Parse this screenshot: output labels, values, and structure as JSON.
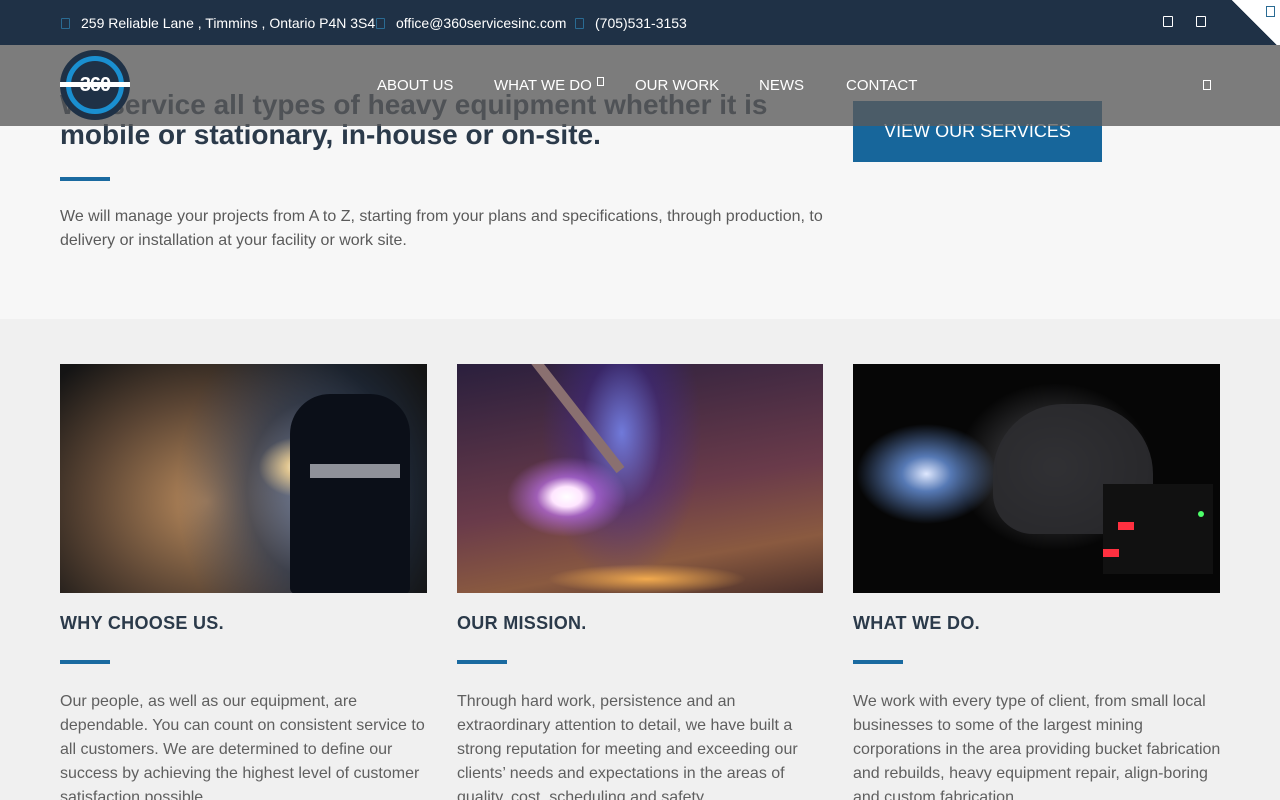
{
  "topbar": {
    "address": "259 Reliable Lane , Timmins , Ontario P4N 3S4",
    "email": "office@360servicesinc.com",
    "phone": "(705)531-3153",
    "icons": [
      "map-marker-icon",
      "envelope-icon",
      "phone-icon",
      "facebook-icon",
      "linkedin-icon"
    ]
  },
  "logo": {
    "text": "360"
  },
  "nav": {
    "items": [
      {
        "label": "ABOUT US"
      },
      {
        "label": "WHAT WE DO"
      },
      {
        "label": "OUR WORK"
      },
      {
        "label": "NEWS"
      },
      {
        "label": "CONTACT"
      }
    ]
  },
  "hero": {
    "title": "We service all types of heavy equipment whether it is mobile or stationary, in-house or on-site.",
    "text": "We will manage your projects from A to Z, starting from your plans and specifications, through production, to delivery or installation at your facility or work site.",
    "cta_label": "VIEW OUR SERVICES"
  },
  "cards": [
    {
      "heading": "WHY CHOOSE US.",
      "body": "Our people, as well as our equipment, are dependable. You can count on consistent service to all customers. We are determined to define our success by achieving the highest level of customer satisfaction possible."
    },
    {
      "heading": "OUR MISSION.",
      "body": "Through hard work, persistence and an extraordinary attention to detail, we have built a strong reputation for meeting and exceeding our clients’ needs and expectations in the areas of quality, cost, scheduling and safety."
    },
    {
      "heading": "WHAT WE DO.",
      "body": "We work with every type of client, from small local businesses to some of the largest mining corporations in the area providing bucket fabrication and rebuilds, heavy equipment repair, align-boring and custom fabrication."
    }
  ],
  "colors": {
    "accent": "#17669b",
    "topbar": "#1f3146"
  }
}
